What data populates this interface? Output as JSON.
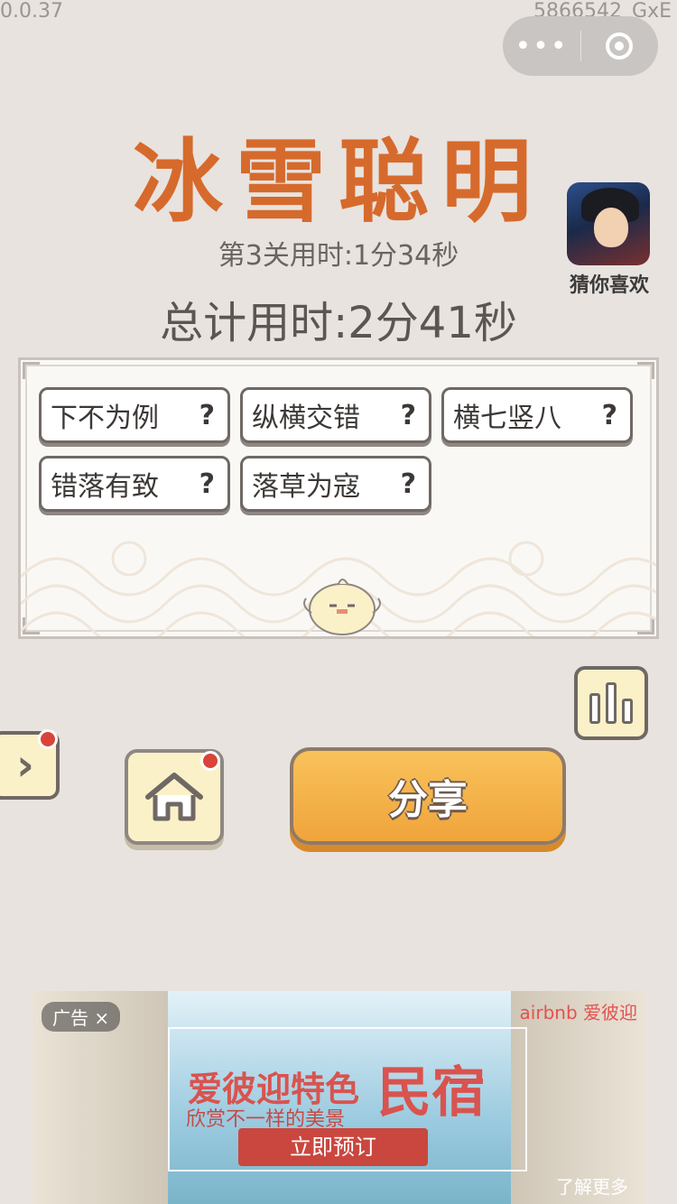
{
  "status": {
    "version": "0.0.37",
    "build": "5866542_GxE"
  },
  "capsule": {
    "more_label": "•••"
  },
  "header": {
    "game_title": "冰雪聪明",
    "level_time": "第3关用时:1分34秒",
    "total_time": "总计用时:2分41秒"
  },
  "recommend": {
    "label": "猜你喜欢"
  },
  "idioms": [
    {
      "text": "下不为例",
      "help": "?"
    },
    {
      "text": "纵横交错",
      "help": "?"
    },
    {
      "text": "横七竖八",
      "help": "?"
    },
    {
      "text": "错落有致",
      "help": "?"
    },
    {
      "text": "落草为寇",
      "help": "?"
    }
  ],
  "actions": {
    "share_label": "分享",
    "side_label": "›"
  },
  "ad": {
    "tag": "广告 ×",
    "brand": "airbnb 爱彼迎",
    "headline_a": "爱彼迎特色",
    "headline_b": "民宿",
    "subline": "欣赏不一样的美景",
    "cta": "立即预订",
    "footer": "了解更多"
  },
  "colors": {
    "title": "#d66a2c",
    "share": "#f0a43b",
    "badge": "#d9433a"
  }
}
